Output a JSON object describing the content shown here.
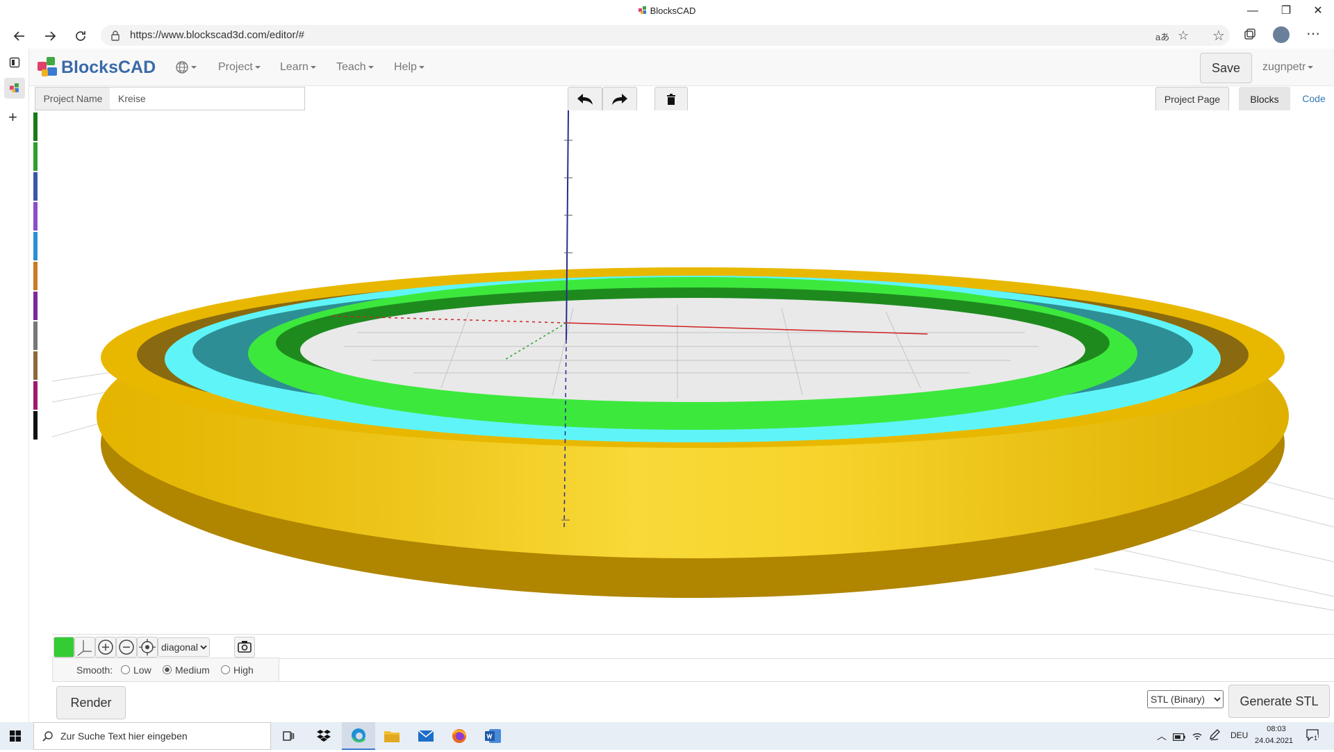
{
  "window": {
    "title": "BlocksCAD",
    "minimize": "—",
    "restore": "❐",
    "close": "✕"
  },
  "browser": {
    "url": "https://www.blockscad3d.com/editor/#",
    "back_icon": "arrow-left-icon",
    "forward_icon": "arrow-right-icon",
    "reload_icon": "reload-icon"
  },
  "header": {
    "logo_text": "BlocksCAD",
    "menus": [
      "Project",
      "Learn",
      "Teach",
      "Help"
    ],
    "save_label": "Save",
    "user": "zugnpetr"
  },
  "project": {
    "name_label": "Project Name",
    "name_value": "Kreise",
    "project_page_label": "Project Page",
    "blocks_tab": "Blocks",
    "code_tab": "Code"
  },
  "category_colors": [
    "#1b7a1b",
    "#2e9e2e",
    "#3a57a8",
    "#8a4fc8",
    "#2a8fd6",
    "#c87a28",
    "#7a2a9a",
    "#777777",
    "#8c6a3c",
    "#a01a6a",
    "#111111"
  ],
  "render_colors": {
    "gold": "#f2c200",
    "cyan": "#5ff5f8",
    "green": "#3de83d"
  },
  "view": {
    "color_swatch": "#33cc33",
    "view_options": [
      "diagonal"
    ],
    "view_selected": "diagonal"
  },
  "smooth": {
    "label": "Smooth:",
    "options": [
      "Low",
      "Medium",
      "High"
    ],
    "selected": "Medium"
  },
  "actions": {
    "render_label": "Render",
    "format_selected": "STL (Binary)",
    "generate_label": "Generate STL"
  },
  "taskbar": {
    "search_placeholder": "Zur Suche Text hier eingeben",
    "language": "DEU",
    "time": "08:03",
    "date": "24.04.2021",
    "notification_count": "1"
  }
}
